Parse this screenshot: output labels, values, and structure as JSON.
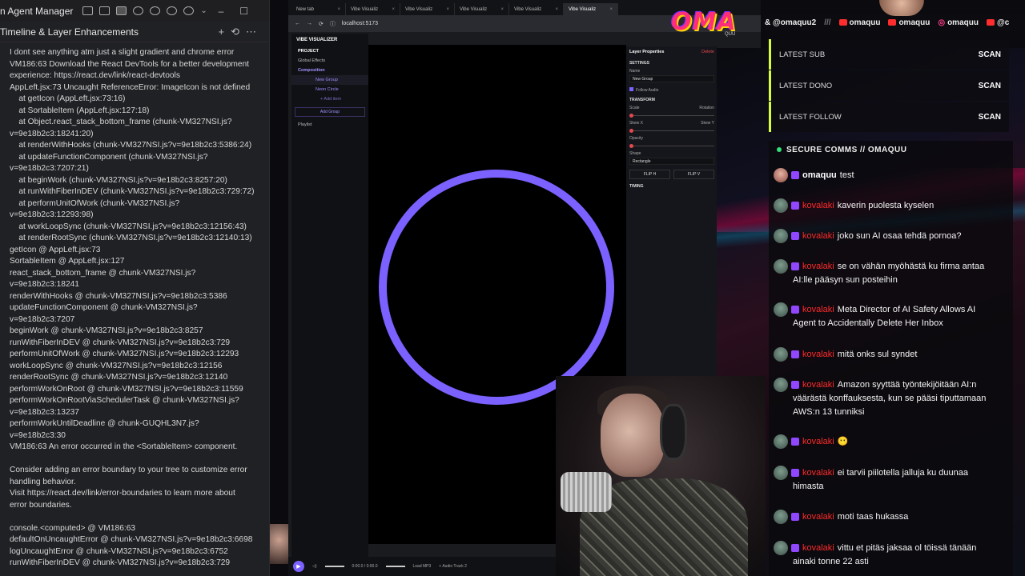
{
  "agent": {
    "title": "n Agent Manager",
    "thread_title": "Timeline & Layer Enhancements",
    "console_lines": [
      "I dont see anything atm just a slight gradient and chrome error",
      "VM186:63 Download the React DevTools for a better development",
      "experience: https://react.dev/link/react-devtools",
      "AppLeft.jsx:73 Uncaught ReferenceError: ImageIcon is not defined",
      "    at getIcon (AppLeft.jsx:73:16)",
      "    at SortableItem (AppLeft.jsx:127:18)",
      "    at Object.react_stack_bottom_frame (chunk-VM327NSI.js?",
      "v=9e18b2c3:18241:20)",
      "    at renderWithHooks (chunk-VM327NSI.js?v=9e18b2c3:5386:24)",
      "    at updateFunctionComponent (chunk-VM327NSI.js?",
      "v=9e18b2c3:7207:21)",
      "    at beginWork (chunk-VM327NSI.js?v=9e18b2c3:8257:20)",
      "    at runWithFiberInDEV (chunk-VM327NSI.js?v=9e18b2c3:729:72)",
      "    at performUnitOfWork (chunk-VM327NSI.js?",
      "v=9e18b2c3:12293:98)",
      "    at workLoopSync (chunk-VM327NSI.js?v=9e18b2c3:12156:43)",
      "    at renderRootSync (chunk-VM327NSI.js?v=9e18b2c3:12140:13)",
      "getIcon @ AppLeft.jsx:73",
      "SortableItem @ AppLeft.jsx:127",
      "react_stack_bottom_frame @ chunk-VM327NSI.js?",
      "v=9e18b2c3:18241",
      "renderWithHooks @ chunk-VM327NSI.js?v=9e18b2c3:5386",
      "updateFunctionComponent @ chunk-VM327NSI.js?",
      "v=9e18b2c3:7207",
      "beginWork @ chunk-VM327NSI.js?v=9e18b2c3:8257",
      "runWithFiberInDEV @ chunk-VM327NSI.js?v=9e18b2c3:729",
      "performUnitOfWork @ chunk-VM327NSI.js?v=9e18b2c3:12293",
      "workLoopSync @ chunk-VM327NSI.js?v=9e18b2c3:12156",
      "renderRootSync @ chunk-VM327NSI.js?v=9e18b2c3:12140",
      "performWorkOnRoot @ chunk-VM327NSI.js?v=9e18b2c3:11559",
      "performWorkOnRootViaSchedulerTask @ chunk-VM327NSI.js?",
      "v=9e18b2c3:13237",
      "performWorkUntilDeadline @ chunk-GUQHL3N7.js?",
      "v=9e18b2c3:30",
      "VM186:63 An error occurred in the <SortableItem> component.",
      "",
      "Consider adding an error boundary to your tree to customize error",
      "handling behavior.",
      "Visit https://react.dev/link/error-boundaries to learn more about",
      "error boundaries.",
      "",
      "console.<computed> @ VM186:63",
      "defaultOnUncaughtError @ chunk-VM327NSI.js?v=9e18b2c3:6698",
      "logUncaughtError @ chunk-VM327NSI.js?v=9e18b2c3:6752",
      "runWithFiberInDEV @ chunk-VM327NSI.js?v=9e18b2c3:729"
    ]
  },
  "browser": {
    "tabs": [
      {
        "label": "New tab"
      },
      {
        "label": "Vibe Visualiz"
      },
      {
        "label": "Vibe Visualiz"
      },
      {
        "label": "Vibe Visualiz"
      },
      {
        "label": "Vibe Visualiz"
      },
      {
        "label": "Vibe Visualiz"
      }
    ],
    "url": "localhost:5173"
  },
  "visualizer": {
    "brand": "VIBE VISUALIZER",
    "project": "PROJECT",
    "global_effects": "Global Effects",
    "composition": "Composition",
    "layer_new_group": "New Group",
    "layer_neon_circle": "Neon Circle",
    "add_item": "+ Add item",
    "add_group": "Add Group",
    "playlist": "Playlist",
    "props_title": "Layer Properties",
    "delete": "Delete",
    "settings": "SETTINGS",
    "name_label": "Name",
    "name_value": "New Group",
    "follow_audio": "Follow Audio",
    "transform": "TRANSFORM",
    "scale": "Scale",
    "rotation": "Rotation",
    "skew_x": "Skew X",
    "skew_y": "Skew Y",
    "opacity": "Opacity",
    "shape_label": "Shape",
    "shape_value": "Rectangle",
    "flip_h": "FLIP H",
    "flip_v": "FLIP V",
    "timing": "TIMING",
    "time": "0:00.0 / 0:00.0",
    "load_mp3": "Load MP3",
    "audio_track": "+ Audio Track 2",
    "ring_color": "#7b61ff"
  },
  "overlay": {
    "logo": "OMA",
    "logo_sub": "QUU",
    "socials": [
      {
        "type": "handle",
        "text": "& @omaquu2"
      },
      {
        "type": "sep",
        "text": "///"
      },
      {
        "type": "yt",
        "text": "omaquu"
      },
      {
        "type": "yt",
        "text": "omaquu"
      },
      {
        "type": "ig",
        "text": "omaquu"
      },
      {
        "type": "yt",
        "text": "@c"
      }
    ],
    "stats": [
      {
        "label": "LATEST SUB",
        "value": "SCAN"
      },
      {
        "label": "LATEST DONO",
        "value": "SCAN"
      },
      {
        "label": "LATEST FOLLOW",
        "value": "SCAN"
      }
    ],
    "chat_title": "SECURE COMMS // OMAQUU",
    "messages": [
      {
        "user": "omaquu",
        "owner": true,
        "lines": [
          "test"
        ]
      },
      {
        "user": "kovalaki",
        "lines": [
          "kaverin puolesta kyselen"
        ]
      },
      {
        "user": "kovalaki",
        "lines": [
          "joko sun AI osaa tehdä pornoa?"
        ]
      },
      {
        "user": "kovalaki",
        "lines": [
          "se on vähän myöhästä ku firma antaa",
          "AI:lle pääsyn sun posteihin"
        ]
      },
      {
        "user": "kovalaki",
        "lines": [
          "Meta Director of AI Safety Allows AI",
          "Agent to Accidentally Delete Her Inbox"
        ]
      },
      {
        "user": "kovalaki",
        "lines": [
          "mitä onks sul syndet"
        ]
      },
      {
        "user": "kovalaki",
        "lines": [
          "Amazon syyttää työntekijöitään AI:n",
          "väärästä konffauksesta, kun se pääsi tiputtamaan",
          "AWS:n 13 tunniksi"
        ]
      },
      {
        "user": "kovalaki",
        "lines": [
          "😶"
        ]
      },
      {
        "user": "kovalaki",
        "lines": [
          "ei tarvii piilotella jalluja ku duunaa",
          "himasta"
        ]
      },
      {
        "user": "kovalaki",
        "lines": [
          "moti taas hukassa"
        ]
      },
      {
        "user": "kovalaki",
        "lines": [
          "vittu et pitäs jaksaa ol töissä tänään",
          "ainaki tonne 22 asti"
        ]
      }
    ]
  }
}
